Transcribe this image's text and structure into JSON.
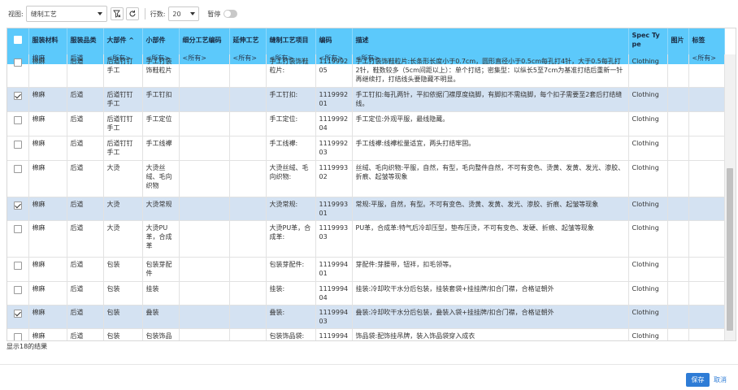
{
  "toolbar": {
    "view_label": "视图:",
    "view_value": "缝制工艺",
    "rows_label": "行数:",
    "rows_value": "20",
    "pause_label": "暂停"
  },
  "columns": [
    "",
    "服装材料",
    "服装品类",
    "大部件 ^",
    "小部件",
    "细分工艺编码",
    "延伸工艺",
    "缝制工艺项目",
    "编码",
    "描述",
    "Spec Type",
    "图片",
    "标签"
  ],
  "filter_row": [
    "",
    "棉麻",
    "后道",
    "<所有>",
    "<所有>",
    "<所有>",
    "<所有>",
    "<所有>",
    "<所有>",
    "<所有>",
    "",
    "",
    "<所有>"
  ],
  "rows": [
    {
      "checked": false,
      "cells": [
        "棉麻",
        "后道",
        "后道钉钉手工",
        "手工打装饰鞋粒片",
        "",
        "",
        "手工打装饰鞋粒片:",
        "111999205",
        "手工打装饰鞋粒片:长条形长度小于0.7cm，圆形直径小于0.5cm每孔打4针，大于0.5每孔打2针，鞋数较多（5cm间距以上）：单个打结；密集型：以纵长5至7cm为基准打结后重新一针再继续打，打结线头要隐藏不明显。",
        "Clothing",
        "",
        ""
      ]
    },
    {
      "checked": true,
      "cells": [
        "棉麻",
        "后道",
        "后道钉钉手工",
        "手工钉扣",
        "",
        "",
        "手工钉扣:",
        "111999201",
        "手工钉扣:每孔两针，平扣依据门襟厚度绕脚，有脚扣不需绕脚，每个扣子需要至2套后打结缝线。",
        "Clothing",
        "",
        ""
      ]
    },
    {
      "checked": false,
      "cells": [
        "棉麻",
        "后道",
        "后道钉钉手工",
        "手工定位",
        "",
        "",
        "手工定位:",
        "111999204",
        "手工定位:外观平服，最线隐藏。",
        "Clothing",
        "",
        ""
      ]
    },
    {
      "checked": false,
      "cells": [
        "棉麻",
        "后道",
        "后道钉钉手工",
        "手工线襻",
        "",
        "",
        "手工线襻:",
        "111999203",
        "手工线襻:线襻松量适宜，两头打结牢固。",
        "Clothing",
        "",
        ""
      ]
    },
    {
      "checked": false,
      "cells": [
        "棉麻",
        "后道",
        "大烫",
        "大烫丝绒、毛向织物",
        "",
        "",
        "大烫丝绒、毛向织物:",
        "111999302",
        "丝绒、毛向织物:平服，自然，有型，毛向整件自然，不可有变色、烫黄、发黄、发光、渗胶、折痕、起皱等现象",
        "Clothing",
        "",
        ""
      ]
    },
    {
      "checked": true,
      "cells": [
        "棉麻",
        "后道",
        "大烫",
        "大烫常规",
        "",
        "",
        "大烫常规:",
        "111999301",
        "常规:平服，自然，有型。不可有变色、烫黄、发黄、发光、渗胶、折痕、起皱等现象",
        "Clothing",
        "",
        ""
      ]
    },
    {
      "checked": false,
      "cells": [
        "棉麻",
        "后道",
        "大烫",
        "大烫PU革，合成革",
        "",
        "",
        "大烫PU革，合成革:",
        "111999303",
        "PU革，合成革:特气后冷却压型，垫布压烫，不可有变色、发硬、折痕、起皱等现象",
        "Clothing",
        "",
        ""
      ]
    },
    {
      "checked": false,
      "cells": [
        "棉麻",
        "后道",
        "包装",
        "包装芽配件",
        "",
        "",
        "包装芽配件:",
        "111999401",
        "芽配件:芽腰带，钮袢，扣毛领等。",
        "Clothing",
        "",
        ""
      ]
    },
    {
      "checked": false,
      "cells": [
        "棉麻",
        "后道",
        "包装",
        "挂装",
        "",
        "",
        "挂装:",
        "111999404",
        "挂装:冷却吹干水分后包装，挂装套袋+挂挂牌/扣合门襟，合格证朝外",
        "Clothing",
        "",
        ""
      ]
    },
    {
      "checked": true,
      "cells": [
        "棉麻",
        "后道",
        "包装",
        "叠装",
        "",
        "",
        "叠装:",
        "111999403",
        "叠装:冷却吹干水分后包装，叠装入袋+挂挂牌/扣合门襟，合格证朝外",
        "Clothing",
        "",
        ""
      ]
    },
    {
      "checked": false,
      "cells": [
        "棉麻",
        "后道",
        "包装",
        "包装饰品袋",
        "",
        "",
        "包装饰品袋:",
        "111999402",
        "饰品袋:配饰挂吊牌，装入饰品袋穿入成衣",
        "Clothing",
        "",
        ""
      ]
    }
  ],
  "status_text": "显示18的结果",
  "buttons": {
    "save": "保存",
    "cancel": "取消"
  },
  "colors": {
    "header_bg": "#5cc9fb",
    "selected_row": "#d4e2f2",
    "primary": "#2e7cd6"
  }
}
